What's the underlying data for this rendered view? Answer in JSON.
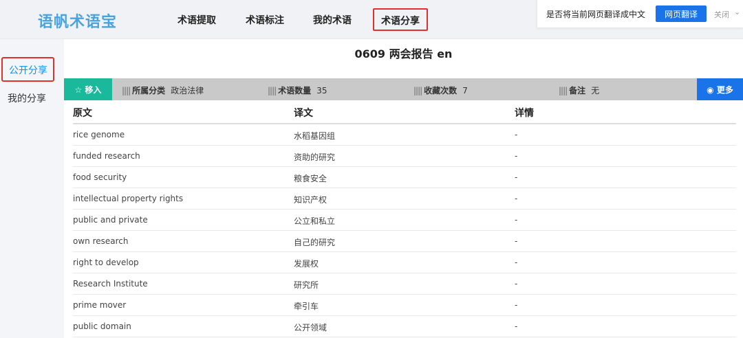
{
  "app": {
    "logo": "语帆术语宝"
  },
  "nav": [
    {
      "label": "术语提取"
    },
    {
      "label": "术语标注"
    },
    {
      "label": "我的术语"
    },
    {
      "label": "术语分享"
    }
  ],
  "translate_bar": {
    "prompt": "是否将当前网页翻译成中文",
    "button": "网页翻译",
    "close": "关闭"
  },
  "sidebar": [
    {
      "label": "公开分享"
    },
    {
      "label": "我的分享"
    }
  ],
  "page": {
    "title": "0609 两会报告 en"
  },
  "infobar": {
    "move_label": "☆ 移入",
    "category_label": "所属分类",
    "category_value": "政治法律",
    "count_label": "术语数量",
    "count_value": "35",
    "fav_label": "收藏次数",
    "fav_value": "7",
    "note_label": "备注",
    "note_value": "无",
    "more_label": "更多"
  },
  "table": {
    "headers": [
      "原文",
      "译文",
      "详情"
    ],
    "rows": [
      [
        "rice genome",
        "水稻基因组",
        "-"
      ],
      [
        "funded research",
        "资助的研究",
        "-"
      ],
      [
        "food security",
        "粮食安全",
        "-"
      ],
      [
        "intellectual property rights",
        "知识产权",
        "-"
      ],
      [
        "public and private",
        "公立和私立",
        "-"
      ],
      [
        "own research",
        "自己的研究",
        "-"
      ],
      [
        "right to develop",
        "发展权",
        "-"
      ],
      [
        "Research Institute",
        "研究所",
        "-"
      ],
      [
        "prime mover",
        "牵引车",
        "-"
      ],
      [
        "public domain",
        "公开领域",
        "-"
      ]
    ]
  }
}
